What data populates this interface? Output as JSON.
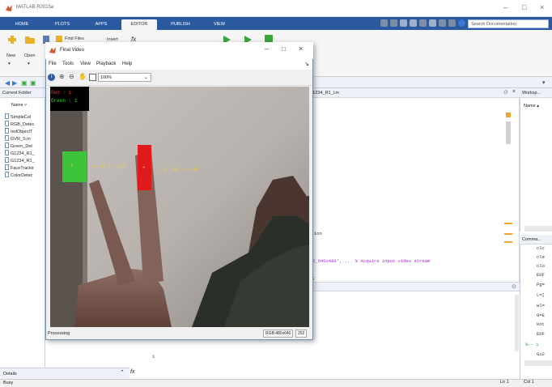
{
  "matlab": {
    "title": "MATLAB R2015a",
    "tabs": [
      "HOME",
      "PLOTS",
      "APPS",
      "EDITOR",
      "PUBLISH",
      "VIEW"
    ],
    "active_tab": "EDITOR",
    "search_placeholder": "Search Documentation",
    "ribbon": {
      "find_files": "Find Files",
      "insert": "Insert",
      "fx": "fx",
      "new": "New",
      "open": "Open"
    },
    "current_folder": {
      "header": "Current Folder",
      "column": "Name",
      "files": [
        "SimpleCol",
        "RGB_Detec",
        "redObjectT",
        "GVR_S.m",
        "Green_Det",
        "G1234_R1_",
        "G1234_R1_",
        "FaceTrackir",
        "ColorDetec"
      ]
    },
    "editor": {
      "file_tab": "G1234_R1_l.m",
      "line_fragment_1": "ion",
      "line_fragment_2": "2_640x480', ... % Acquire input video stream",
      "line_fragment_3": ";"
    },
    "command_window": {
      "line_number": "1"
    },
    "workspace": {
      "header": "Worksp...",
      "column": "Name"
    },
    "history": {
      "header": "Comma...",
      "lines": [
        "clc",
        "cle",
        "clo",
        "EDF",
        "Pg=",
        "L=[",
        "wl=",
        "G=E",
        "kot",
        "EDF",
        "%-- 1",
        "G12"
      ]
    },
    "details": "Details",
    "status": "Busy",
    "cursor": {
      "ln": "Ln 1",
      "col": "Col 1"
    }
  },
  "video_window": {
    "title": "Final Video",
    "menu": [
      "File",
      "Tools",
      "View",
      "Playback",
      "Help"
    ],
    "zoom": "100%",
    "status_left": "Processing",
    "status_size": "RGB:480x640",
    "status_val": "252",
    "overlay": {
      "red_count_label": "Red :",
      "red_count": "1",
      "green_count_label": "Green :",
      "green_count": "1",
      "green_coords": "X: 81  Y: 163",
      "red_coords": "X: 108  Y: 145"
    },
    "colors": {
      "red_box": "#e01a1a",
      "green_box": "#3ec43a",
      "yellow_text": "#e8d23a"
    }
  }
}
